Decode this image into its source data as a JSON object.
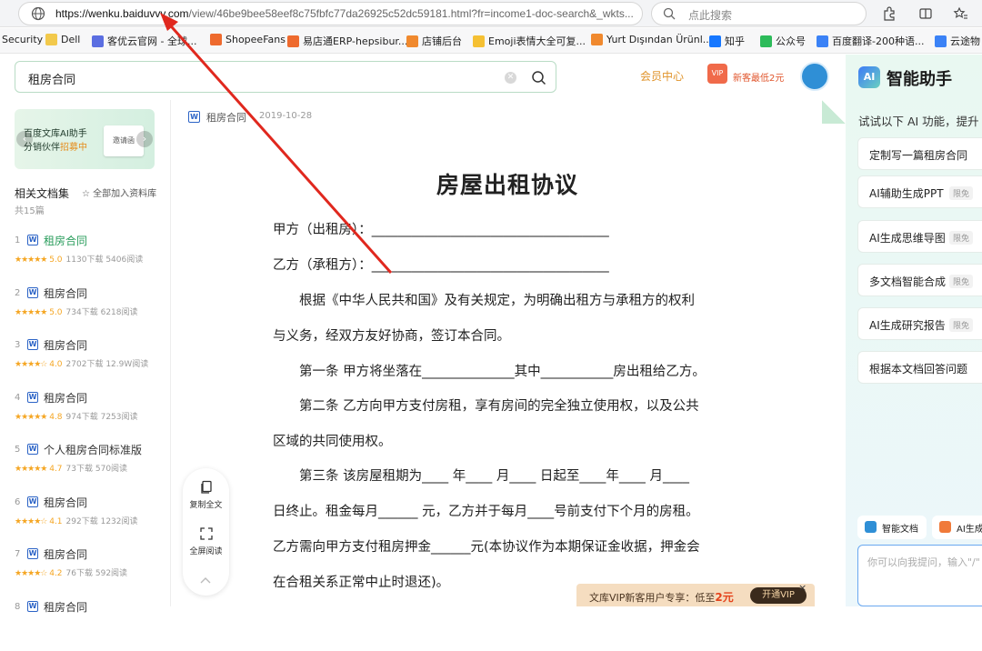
{
  "browser": {
    "url_host": "https://wenku.baiduvvv.com",
    "url_path": "/view/46be9bee58eef8c75fbfc77da26925c52dc59181.html?fr=income1-doc-search&_wkts...",
    "search_placeholder": "点此搜索",
    "bookmarks": [
      {
        "label": "Security",
        "color": "#ffffff"
      },
      {
        "label": "Dell",
        "color": "#f2c94c"
      },
      {
        "label": "客优云官网 - 全球...",
        "color": "#5b6ee1"
      },
      {
        "label": "ShopeeFans",
        "color": "#ee6a2e"
      },
      {
        "label": "易店通ERP-hepsibur...",
        "color": "#ee6a2e"
      },
      {
        "label": "店铺后台",
        "color": "#f0892e"
      },
      {
        "label": "Emoji表情大全可复...",
        "color": "#f5c033"
      },
      {
        "label": "Yurt Dışından Ürünl...",
        "color": "#f0892e"
      },
      {
        "label": "知乎",
        "color": "#1677ff"
      },
      {
        "label": "公众号",
        "color": "#2dbb5a"
      },
      {
        "label": "百度翻译-200种语...",
        "color": "#3b82f6"
      },
      {
        "label": "云途物",
        "color": "#3b82f6"
      }
    ]
  },
  "header": {
    "search_query": "租房合同",
    "vip_center": "会员中心",
    "gift_label": "VIP",
    "newbie_offer": "新客最低2元"
  },
  "sidebar": {
    "banner_line1": "百度文库AI助手",
    "banner_line2": "分销伙伴",
    "banner_line2_highlight": "招募中",
    "banner_card": "邀请函",
    "related_title": "相关文档集",
    "related_add": "☆ 全部加入资料库",
    "related_count": "共15篇",
    "items": [
      {
        "num": "1",
        "name": "租房合同",
        "score": "5.0",
        "stars": "★★★★★",
        "downloads": "1130下载",
        "reads": "5406阅读"
      },
      {
        "num": "2",
        "name": "租房合同",
        "score": "5.0",
        "stars": "★★★★★",
        "downloads": "734下载",
        "reads": "6218阅读"
      },
      {
        "num": "3",
        "name": "租房合同",
        "score": "4.0",
        "stars": "★★★★☆",
        "downloads": "2702下载",
        "reads": "12.9W阅读"
      },
      {
        "num": "4",
        "name": "租房合同",
        "score": "4.8",
        "stars": "★★★★★",
        "downloads": "974下载",
        "reads": "7253阅读"
      },
      {
        "num": "5",
        "name": "个人租房合同标准版",
        "score": "4.7",
        "stars": "★★★★★",
        "downloads": "73下载",
        "reads": "570阅读"
      },
      {
        "num": "6",
        "name": "租房合同",
        "score": "4.1",
        "stars": "★★★★☆",
        "downloads": "292下载",
        "reads": "1232阅读"
      },
      {
        "num": "7",
        "name": "租房合同",
        "score": "4.2",
        "stars": "★★★★☆",
        "downloads": "76下载",
        "reads": "592阅读"
      },
      {
        "num": "8",
        "name": "租房合同",
        "score": "",
        "stars": "",
        "downloads": "",
        "reads": ""
      }
    ]
  },
  "document": {
    "name": "租房合同",
    "date": "2019-10-28",
    "title": "房屋出租协议",
    "lines": [
      "甲方（出租房）：____________________________________",
      "乙方（承租方）：____________________________________",
      "　　根据《中华人民共和国》及有关规定，为明确出租方与承租方的权利",
      "与义务，经双方友好协商，签订本合同。",
      "　　第一条  甲方将坐落在______________其中___________房出租给乙方。",
      "　　第二条  乙方向甲方支付房租，享有房间的完全独立使用权，以及公共",
      "区域的共同使用权。",
      "　　第三条  该房屋租期为____ 年____ 月____ 日起至____年____ 月____",
      "日终止。租金每月______  元，乙方并于每月____号前支付下个月的房租。",
      "乙方需向甲方支付租房押金______元(本协议作为本期保证金收据，押金会",
      "在合租关系正常中止时退还)。"
    ],
    "tools": {
      "copy": "复制全文",
      "fullscreen": "全屏阅读"
    },
    "vip_bar": {
      "prefix": "文库VIP新客用户专享：低至",
      "price": "2元",
      "button": "开通VIP",
      "close": "×"
    }
  },
  "ai_panel": {
    "logo": "AI",
    "title": "智能助手",
    "subtitle": "试试以下 AI 功能，提升",
    "buttons": [
      {
        "label": "定制写一篇租房合同",
        "tag": ""
      },
      {
        "label": "AI辅助生成PPT",
        "tag": "限免"
      },
      {
        "label": "AI生成思维导图",
        "tag": "限免"
      },
      {
        "label": "多文档智能合成",
        "tag": "限免"
      },
      {
        "label": "AI生成研究报告",
        "tag": "限免"
      },
      {
        "label": "根据本文档回答问题",
        "tag": ""
      }
    ],
    "tab_doc": "智能文档",
    "tab_gen": "AI生成",
    "input_placeholder": "你可以向我提问，输入\"/\""
  },
  "colors": {
    "accent_green": "#2a9d5c",
    "annotation_red": "#e0281e",
    "vip_orange": "#e0932a"
  }
}
